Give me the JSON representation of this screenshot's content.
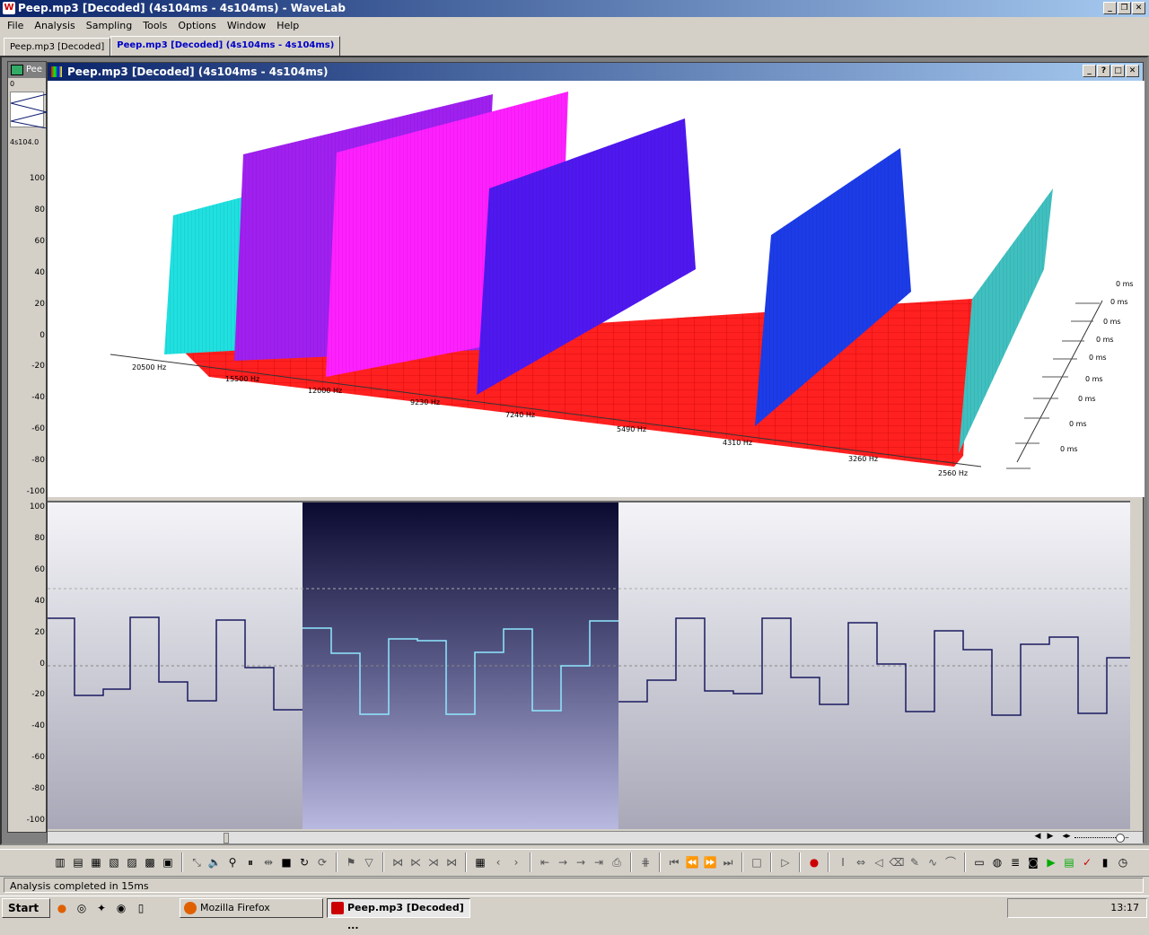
{
  "app": {
    "title": "Peep.mp3 [Decoded] (4s104ms - 4s104ms) - WaveLab",
    "icon_letter": "W"
  },
  "menu": [
    "File",
    "Analysis",
    "Sampling",
    "Tools",
    "Options",
    "Window",
    "Help"
  ],
  "tabs": [
    {
      "label": "Peep.mp3 [Decoded]"
    },
    {
      "label": "Peep.mp3 [Decoded] (4s104ms - 4s104ms)"
    }
  ],
  "bgwindow": {
    "title": "Pee",
    "time": "4s104.0",
    "zero": "0"
  },
  "analysis_window": {
    "title": "Peep.mp3 [Decoded] (4s104ms - 4s104ms)",
    "scale_labels": [
      "100",
      "80",
      "60",
      "40",
      "20",
      "0",
      "-20",
      "-40",
      "-60",
      "-80",
      "-100"
    ],
    "freq_labels": [
      "20500 Hz",
      "15500 Hz",
      "12000 Hz",
      "9230 Hz",
      "7240 Hz",
      "5490 Hz",
      "4310 Hz",
      "3260 Hz",
      "2560 Hz"
    ],
    "time_labels": [
      "0 ms",
      "0 ms",
      "0 ms",
      "0 ms",
      "0 ms",
      "0 ms",
      "0 ms",
      "0 ms",
      "0 ms"
    ]
  },
  "wave": {
    "scale_labels": [
      "100",
      "80",
      "60",
      "40",
      "20",
      "0",
      "-20",
      "-40",
      "-60",
      "-80",
      "-100"
    ]
  },
  "colors": {
    "floor": "#ff2020",
    "cyan": "#20e0e0",
    "violet": "#a020f0",
    "magenta": "#ff20ff",
    "indigo": "#5018f0",
    "blue": "#1c3ce8",
    "teal": "#40c0c0",
    "title_active": "#0a246a"
  },
  "status": {
    "text": "Analysis completed in 15ms"
  },
  "taskbar": {
    "start": "Start",
    "items": [
      {
        "label": "Mozilla Firefox"
      },
      {
        "label": "Peep.mp3 [Decoded] ..."
      }
    ],
    "clock": "13:17"
  }
}
